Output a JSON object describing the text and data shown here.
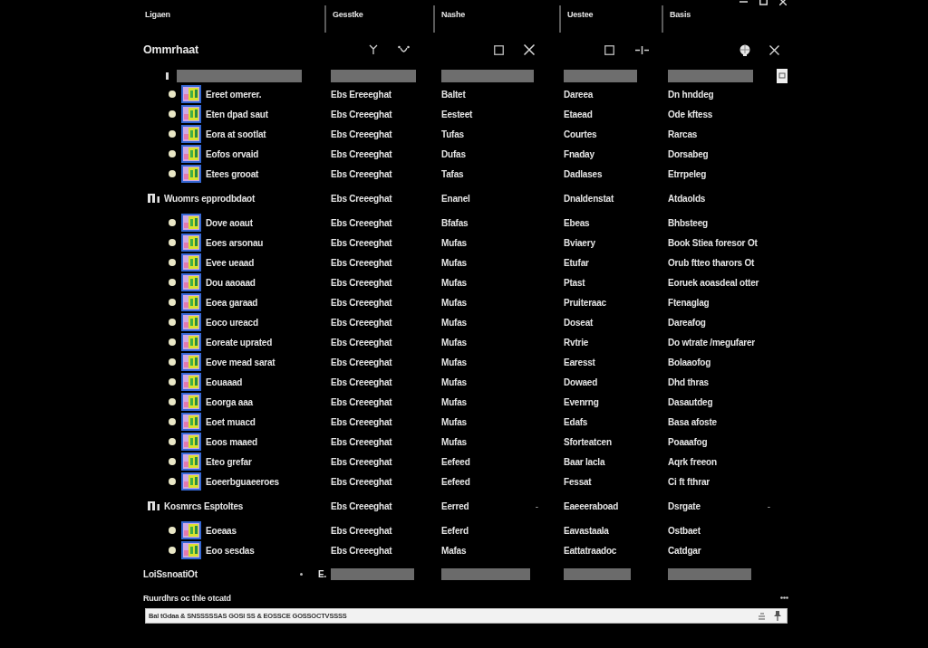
{
  "columns": [
    "Ligaen",
    "Gesstke",
    "Nashe",
    "Uestee",
    "Basis"
  ],
  "panel": {
    "title": "Ommrhaat"
  },
  "groups": [
    {
      "rows": [
        {
          "name": "Ereet omerer.",
          "cells": [
            "Ebs Ereeeghat",
            "Baltet",
            "Dareea",
            "Dn hnddeg"
          ]
        },
        {
          "name": "Eten dpad saut",
          "cells": [
            "Ebs Creeeghat",
            "Eesteet",
            "Etaead",
            "Ode kftess"
          ]
        },
        {
          "name": "Eora at sootlat",
          "cells": [
            "Ebs Creeeghat",
            "Tufas",
            "Courtes",
            "Rarcas"
          ]
        },
        {
          "name": "Eofos orvaid",
          "cells": [
            "Ebs Creeeghat",
            "Dufas",
            "Fnaday",
            "Dorsabeg"
          ]
        },
        {
          "name": "Etees grooat",
          "cells": [
            "Ebs Creeeghat",
            "Tafas",
            "Dadlases",
            "Etrrpeleg"
          ]
        }
      ]
    },
    {
      "header": {
        "title": "Wuomrs epprodbdaot",
        "cells": [
          {
            "text": "Ebs Creeeghat"
          },
          {
            "text": "Enanel"
          },
          {
            "text": "Dnaldenstat"
          },
          {
            "text": "Atdaolds"
          }
        ]
      },
      "rows": [
        {
          "name": "Dove aoaut",
          "cells": [
            "Ebs Creeeghat",
            "Bfafas",
            "Ebeas",
            "Bhbsteeg"
          ]
        },
        {
          "name": "Eoes arsonau",
          "cells": [
            "Ebs Creeeghat",
            "Mufas",
            "Bviaery",
            "Book Stiea foresor Ot"
          ]
        },
        {
          "name": "Evee ueaad",
          "cells": [
            "Ebs Creeeghat",
            "Mufas",
            "Etufar",
            "Orub ftteo tharors Ot"
          ]
        },
        {
          "name": "Dou aaoaad",
          "cells": [
            "Ebs Creeeghat",
            "Mufas",
            "Ptast",
            "Eoruek aoasdeal otter"
          ]
        },
        {
          "name": "Eoea garaad",
          "cells": [
            "Ebs Creeeghat",
            "Mufas",
            "Pruiteraac",
            "Ftenaglag"
          ]
        },
        {
          "name": "Eoco ureacd",
          "cells": [
            "Ebs Creeeghat",
            "Mufas",
            "Doseat",
            "Dareafog"
          ]
        },
        {
          "name": "Eoreate uprated",
          "cells": [
            "Ebs Creeeghat",
            "Mufas",
            "Rvtrie",
            "Do wtrate /megufarer"
          ]
        },
        {
          "name": "Eove mead sarat",
          "cells": [
            "Ebs Creeeghat",
            "Mufas",
            "Earesst",
            "Bolaaofog"
          ]
        },
        {
          "name": "Eouaaad",
          "cells": [
            "Ebs Creeeghat",
            "Mufas",
            "Dowaed",
            "Dhd thras"
          ]
        },
        {
          "name": "Eoorga aaa",
          "cells": [
            "Ebs Creeeghat",
            "Mufas",
            "Evenrng",
            "Dasautdeg"
          ]
        },
        {
          "name": "Eoet muacd",
          "cells": [
            "Ebs Creeeghat",
            "Mufas",
            "Edafs",
            "Basa afoste"
          ]
        },
        {
          "name": "Eoos maaed",
          "cells": [
            "Ebs Creeeghat",
            "Mufas",
            "Sforteatcen",
            "Poaaafog"
          ]
        },
        {
          "name": "Eteo grefar",
          "cells": [
            "Ebs Creeeghat",
            "Eefeed",
            "Baar lacla",
            "Aqrk freeon"
          ]
        },
        {
          "name": "Eoeerbguaeeroes",
          "cells": [
            "Ebs Creeeghat",
            "Eefeed",
            "Fessat",
            "Ci ft fthrar"
          ]
        }
      ]
    },
    {
      "header": {
        "title": "Kosmrcs Esptoltes",
        "cells": [
          {
            "text": "Ebs Creeeghat"
          },
          {
            "text": "Eerred",
            "mark": "-"
          },
          {
            "text": "Eaeeeraboad"
          },
          {
            "text": "Dsrgate",
            "mark": "-"
          }
        ]
      },
      "rows": [
        {
          "name": "Eoeaas",
          "cells": [
            "Ebs Creeeghat",
            "Eeferd",
            "Eavastaala",
            "Ostbaet"
          ]
        },
        {
          "name": "Eoo sesdas",
          "cells": [
            "Ebs Creeeghat",
            "Mafas",
            "Eattatraadoc",
            "Catdgar"
          ]
        }
      ]
    }
  ],
  "summary": {
    "label": "LoiSsnoatiOt",
    "prefix": "E."
  },
  "footer": {
    "caption": "Ruurdhrs oc thle otcatd",
    "value": "Bal tGdaa & SNSSSSSAS GOSI SS & EOSSCE GOSSOCTVSSSS"
  }
}
